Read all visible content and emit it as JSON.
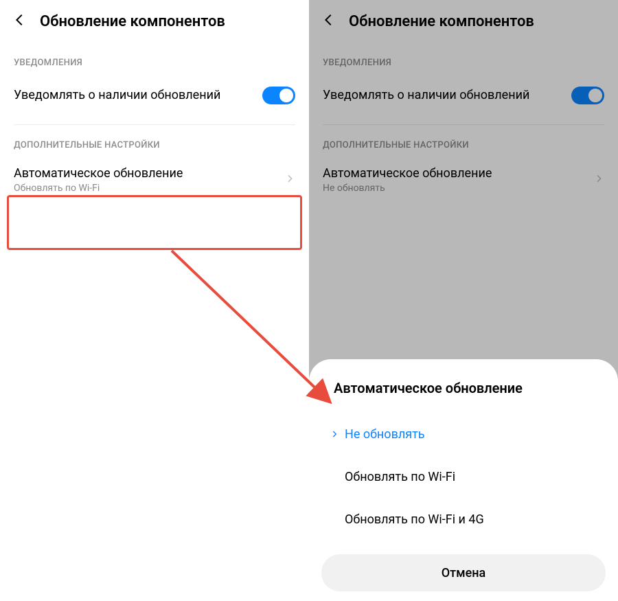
{
  "left": {
    "header_title": "Обновление компонентов",
    "section_notifications": "УВЕДОМЛЕНИЯ",
    "notify_label": "Уведомлять о наличии обновлений",
    "section_additional": "ДОПОЛНИТЕЛЬНЫЕ НАСТРОЙКИ",
    "auto_update_title": "Автоматическое обновление",
    "auto_update_subtitle": "Обновлять по Wi-Fi"
  },
  "right": {
    "header_title": "Обновление компонентов",
    "section_notifications": "УВЕДОМЛЕНИЯ",
    "notify_label": "Уведомлять о наличии обновлений",
    "section_additional": "ДОПОЛНИТЕЛЬНЫЕ НАСТРОЙКИ",
    "auto_update_title": "Автоматическое обновление",
    "auto_update_subtitle": "Не обновлять",
    "sheet": {
      "title": "Автоматическое обновление",
      "options": {
        "no_update": "Не обновлять",
        "wifi": "Обновлять по Wi-Fi",
        "wifi_4g": "Обновлять по Wi-Fi и 4G"
      },
      "cancel": "Отмена"
    }
  },
  "colors": {
    "accent": "#0a84ff",
    "highlight": "#e74c3c"
  }
}
